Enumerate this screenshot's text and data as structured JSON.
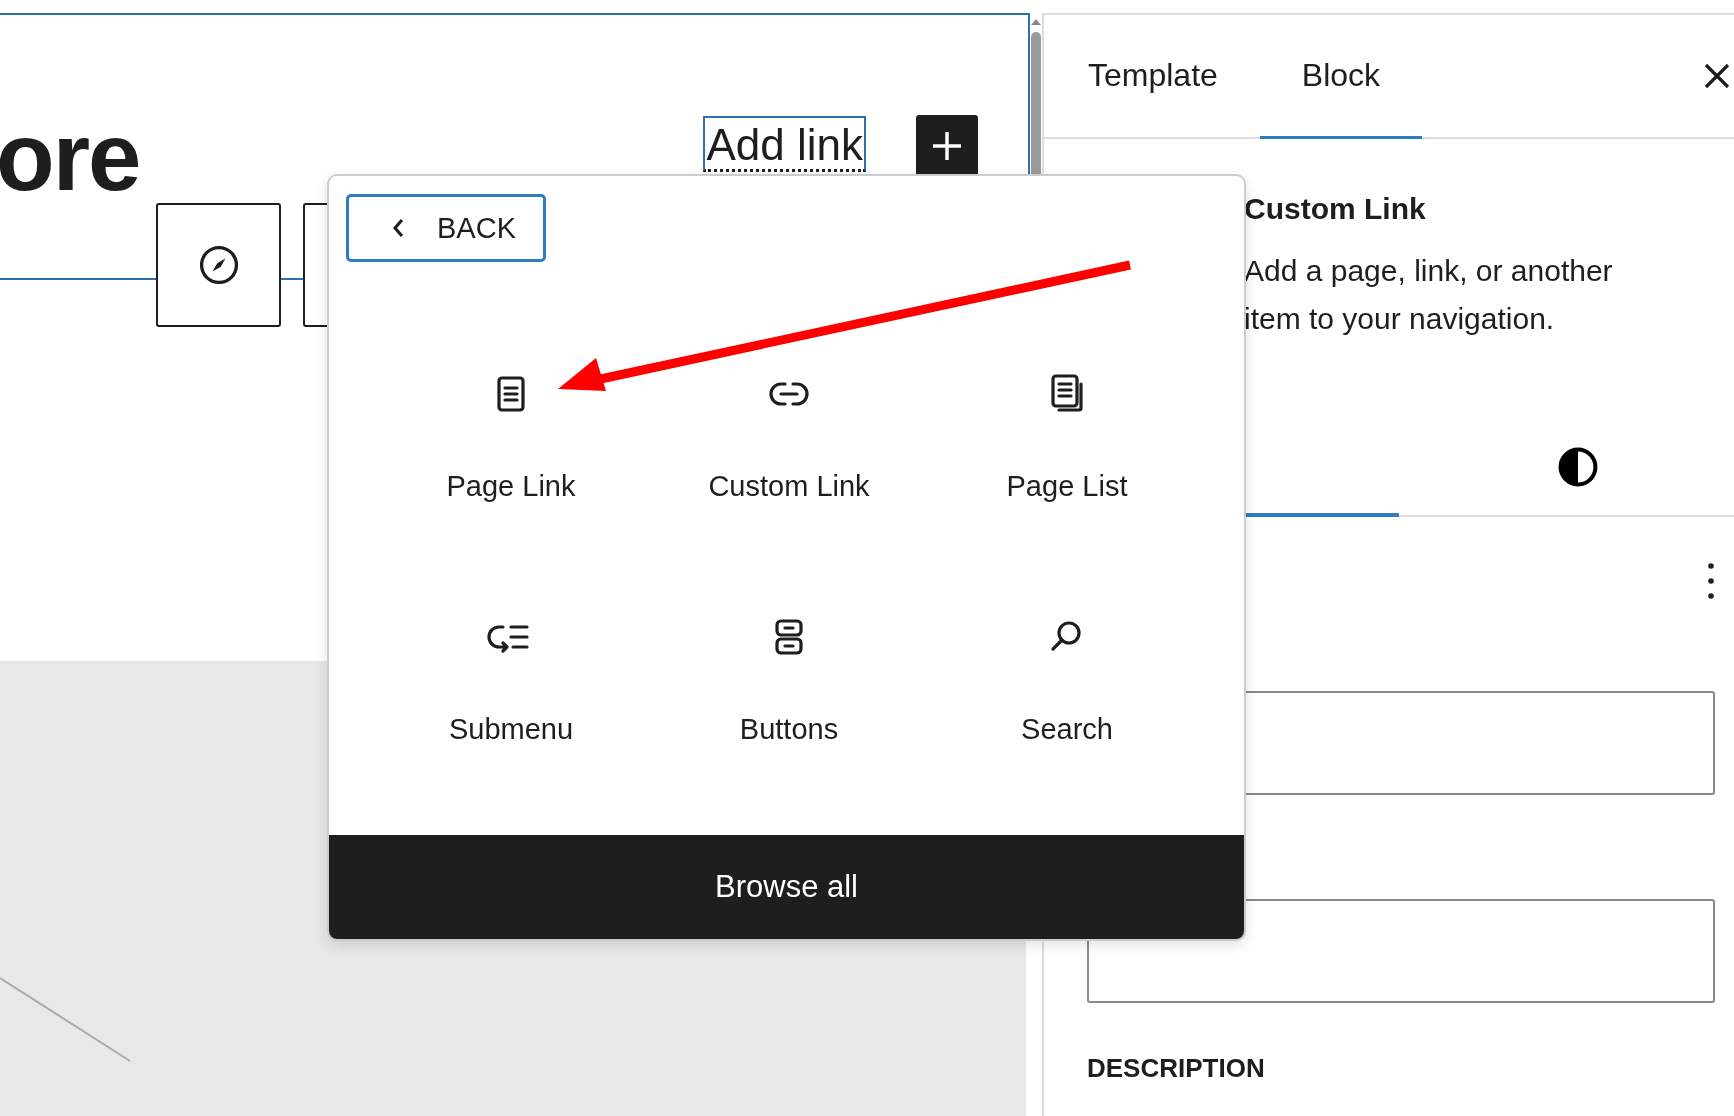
{
  "canvas": {
    "heading": "ore",
    "add_link": "Add link"
  },
  "popover": {
    "back": "BACK",
    "blocks": [
      {
        "kind": "page",
        "label": "Page Link"
      },
      {
        "kind": "link",
        "label": "Custom Link"
      },
      {
        "kind": "pages",
        "label": "Page List"
      },
      {
        "kind": "submenu",
        "label": "Submenu"
      },
      {
        "kind": "buttons",
        "label": "Buttons"
      },
      {
        "kind": "search",
        "label": "Search"
      }
    ],
    "browse_all": "Browse all"
  },
  "sidebar": {
    "tabs": [
      {
        "label": "Template",
        "selected": false
      },
      {
        "label": "Block",
        "selected": true
      }
    ],
    "block_title": "Custom Link",
    "block_description": "Add a page, link, or another item to your navigation.",
    "subtabs": [
      {
        "kind": "settings",
        "selected": true
      },
      {
        "kind": "styles",
        "selected": false
      }
    ],
    "description_label": "DESCRIPTION"
  }
}
